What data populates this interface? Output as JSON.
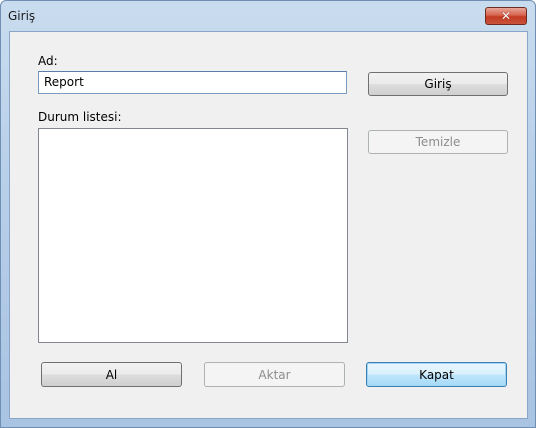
{
  "window": {
    "title": "Giriş",
    "close_symbol": "✕"
  },
  "form": {
    "name_label": "Ad:",
    "name_value": "Report",
    "status_list_label": "Durum listesi:",
    "status_items": []
  },
  "buttons": {
    "login": "Giriş",
    "clear": "Temizle",
    "get": "Al",
    "transfer": "Aktar",
    "close": "Kapat"
  },
  "icons": {
    "close": "close-icon"
  },
  "colors": {
    "title_bar": "#b9d0ea",
    "close_button": "#c9543c",
    "dialog_background": "#f0f0f0",
    "default_button_border": "#3c7fb1"
  }
}
